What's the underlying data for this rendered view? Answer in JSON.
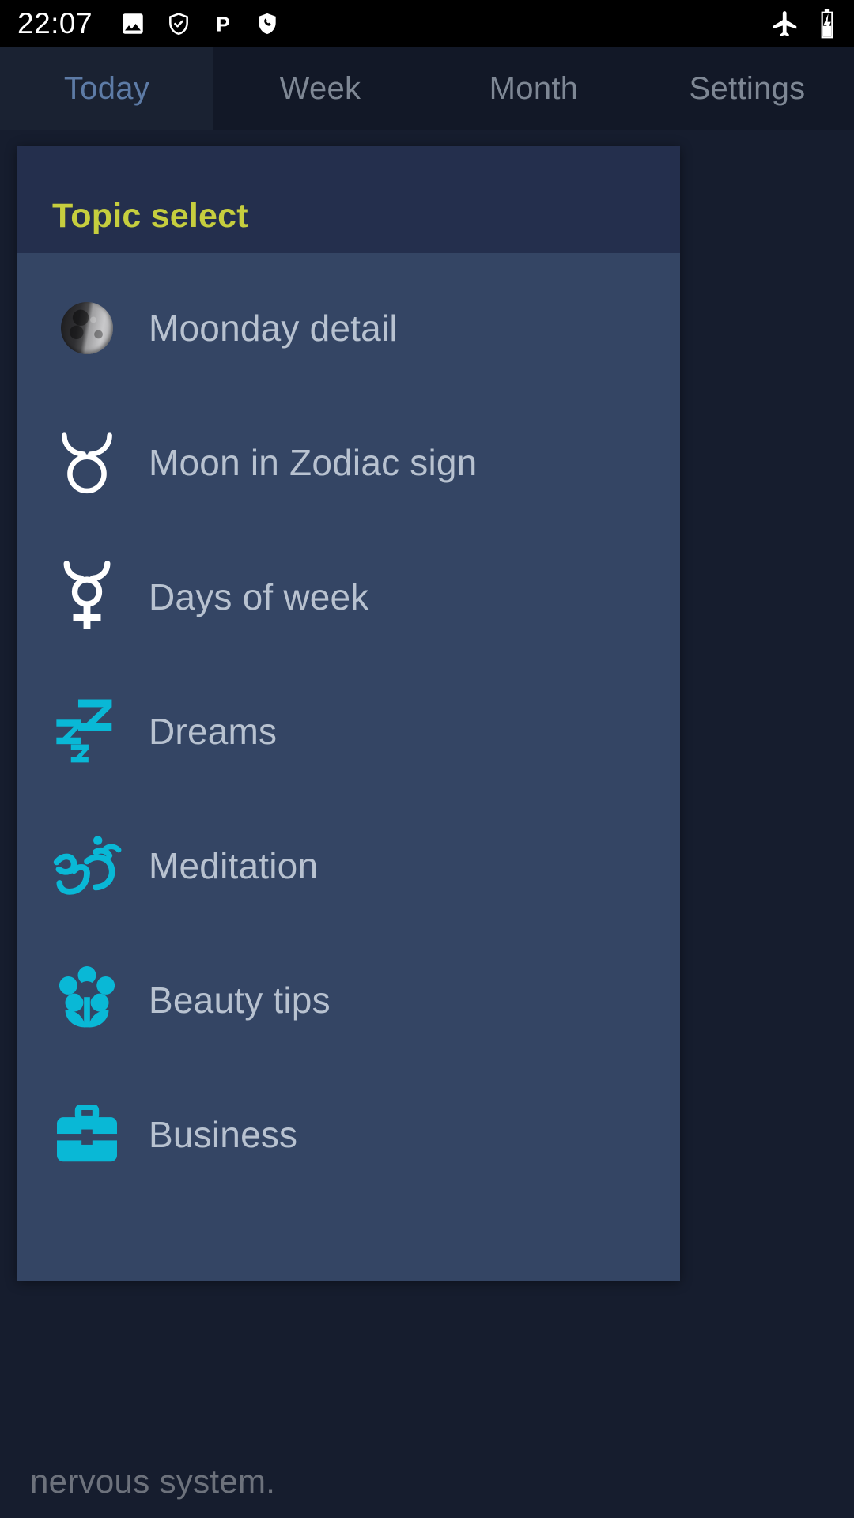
{
  "status_bar": {
    "time": "22:07",
    "left_icons": [
      "image-icon",
      "shield-check-icon",
      "p-badge-icon",
      "shield-phone-icon"
    ],
    "right_icons": [
      "airplane-mode-icon",
      "battery-charging-icon"
    ]
  },
  "tabs": [
    {
      "label": "Today",
      "active": true
    },
    {
      "label": "Week",
      "active": false
    },
    {
      "label": "Month",
      "active": false
    },
    {
      "label": "Settings",
      "active": false
    }
  ],
  "dialog": {
    "title": "Topic select",
    "items": [
      {
        "label": "Moonday detail",
        "icon": "moon-photo-icon"
      },
      {
        "label": "Moon in Zodiac sign",
        "icon": "taurus-zodiac-icon"
      },
      {
        "label": "Days of week",
        "icon": "mercury-symbol-icon"
      },
      {
        "label": "Dreams",
        "icon": "sleep-zzz-icon"
      },
      {
        "label": "Meditation",
        "icon": "om-symbol-icon"
      },
      {
        "label": "Beauty tips",
        "icon": "flower-icon"
      },
      {
        "label": "Business",
        "icon": "briefcase-icon"
      }
    ]
  },
  "background": {
    "visible_text": "nervous system."
  },
  "colors": {
    "accent_title": "#c6ce3e",
    "icon_cyan": "#09b8d6",
    "dialog_body": "#344564",
    "dialog_header": "#242f4d",
    "tab_active_text": "#5d7ba6",
    "tab_inactive_text": "#7e8794"
  }
}
